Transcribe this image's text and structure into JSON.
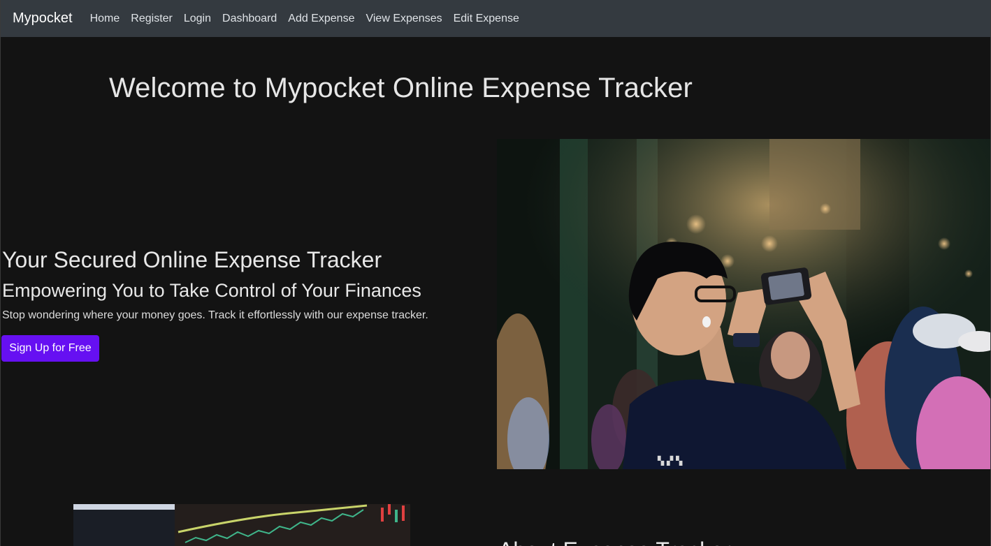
{
  "navbar": {
    "brand": "Mypocket",
    "links": [
      "Home",
      "Register",
      "Login",
      "Dashboard",
      "Add Expense",
      "View Expenses",
      "Edit Expense"
    ]
  },
  "hero": {
    "title": "Welcome to Mypocket Online Expense Tracker",
    "tagline": "Your Secured Online Expense Tracker",
    "subtagline": "Empowering You to Take Control of Your Finances",
    "lead": "Stop wondering where your money goes. Track it effortlessly with our expense tracker.",
    "cta_label": "Sign Up for Free",
    "image": "photo-man-taking-phone-picture-in-crowd"
  },
  "about": {
    "image": "photo-stock-chart-screen",
    "heading": "About Expense Tracker"
  },
  "colors": {
    "navbar_bg": "#343a40",
    "page_bg": "#131313",
    "cta_bg": "#6610f2"
  }
}
